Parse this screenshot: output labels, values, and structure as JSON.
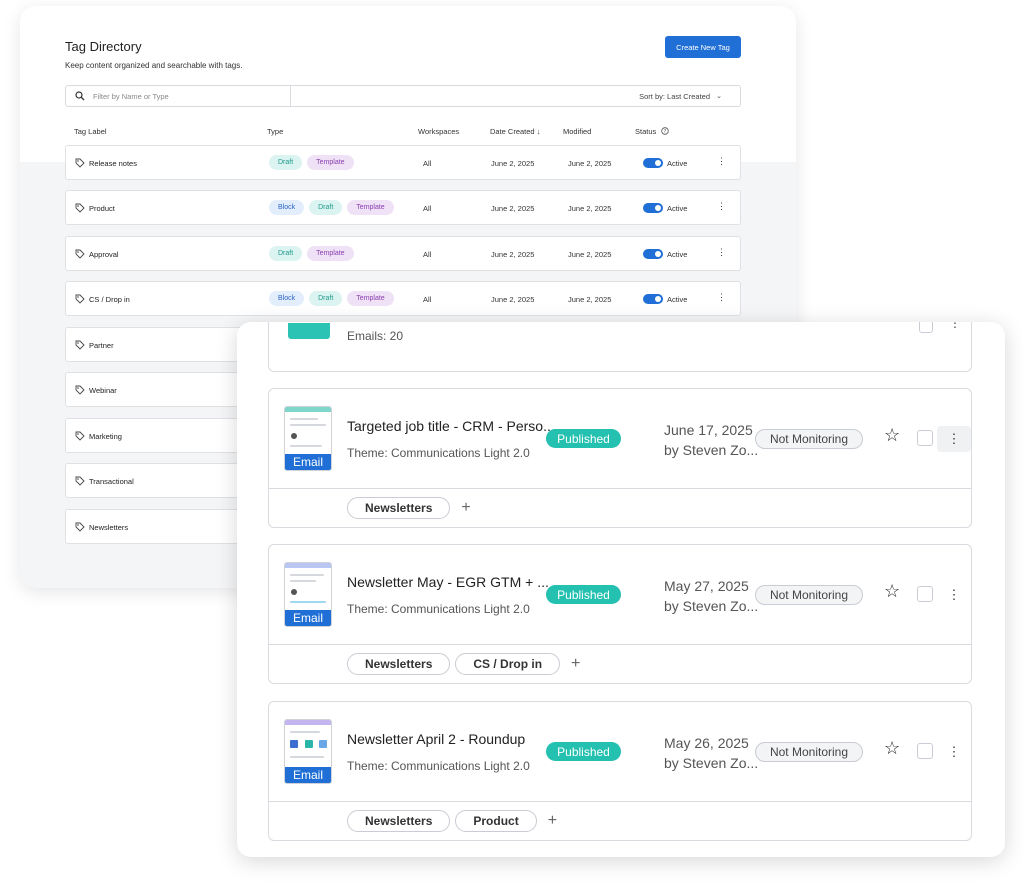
{
  "tag_directory": {
    "title": "Tag Directory",
    "subtitle": "Keep content organized and searchable with tags.",
    "create_button": "Create New Tag",
    "filter_placeholder": "Filter by Name or Type",
    "sort_label": "Sort by: Last Created",
    "columns": [
      "Tag Label",
      "Type",
      "Workspaces",
      "Date Created ↓",
      "Modified",
      "Status"
    ],
    "rows": [
      {
        "label": "Release notes",
        "types": [
          "Draft",
          "Template"
        ],
        "workspaces": "All",
        "created": "June 2, 2025",
        "modified": "June 2, 2025",
        "status": "Active"
      },
      {
        "label": "Product",
        "types": [
          "Block",
          "Draft",
          "Template"
        ],
        "workspaces": "All",
        "created": "June 2, 2025",
        "modified": "June 2, 2025",
        "status": "Active"
      },
      {
        "label": "Approval",
        "types": [
          "Draft",
          "Template"
        ],
        "workspaces": "All",
        "created": "June 2, 2025",
        "modified": "June 2, 2025",
        "status": "Active"
      },
      {
        "label": "CS / Drop in",
        "types": [
          "Block",
          "Draft",
          "Template"
        ],
        "workspaces": "All",
        "created": "June 2, 2025",
        "modified": "June 2, 2025",
        "status": "Active"
      },
      {
        "label": "Partner"
      },
      {
        "label": "Webinar"
      },
      {
        "label": "Marketing"
      },
      {
        "label": "Transactional"
      },
      {
        "label": "Newsletters"
      }
    ]
  },
  "emails": {
    "partial_count": "Emails: 20",
    "items": [
      {
        "title": "Targeted job title - CRM - Perso...",
        "theme": "Theme: Communications Light 2.0",
        "status": "Published",
        "date": "June 17, 2025",
        "by": "by Steven Zo...",
        "monitoring": "Not Monitoring",
        "thumb_label": "Email",
        "tags": [
          "Newsletters"
        ]
      },
      {
        "title": "Newsletter May - EGR GTM + ...",
        "theme": "Theme: Communications Light 2.0",
        "status": "Published",
        "date": "May 27, 2025",
        "by": "by Steven Zo...",
        "monitoring": "Not Monitoring",
        "thumb_label": "Email",
        "tags": [
          "Newsletters",
          "CS / Drop in"
        ]
      },
      {
        "title": "Newsletter April 2 - Roundup",
        "theme": "Theme: Communications Light 2.0",
        "status": "Published",
        "date": "May 26, 2025",
        "by": "by Steven Zo...",
        "monitoring": "Not Monitoring",
        "thumb_label": "Email",
        "tags": [
          "Newsletters",
          "Product"
        ]
      }
    ]
  },
  "colors": {
    "primary": "#1f6fd6",
    "published": "#24c0b0",
    "block_chip": "#e3eefc",
    "draft_chip": "#dcf4f1",
    "template_chip": "#efe1f6"
  },
  "icons": {
    "search": "search-icon",
    "tag": "tag-icon",
    "chevron": "chevron-down-icon",
    "help": "help-circle-icon",
    "star": "star-icon",
    "kebab": "kebab-menu-icon",
    "add": "plus-icon"
  }
}
